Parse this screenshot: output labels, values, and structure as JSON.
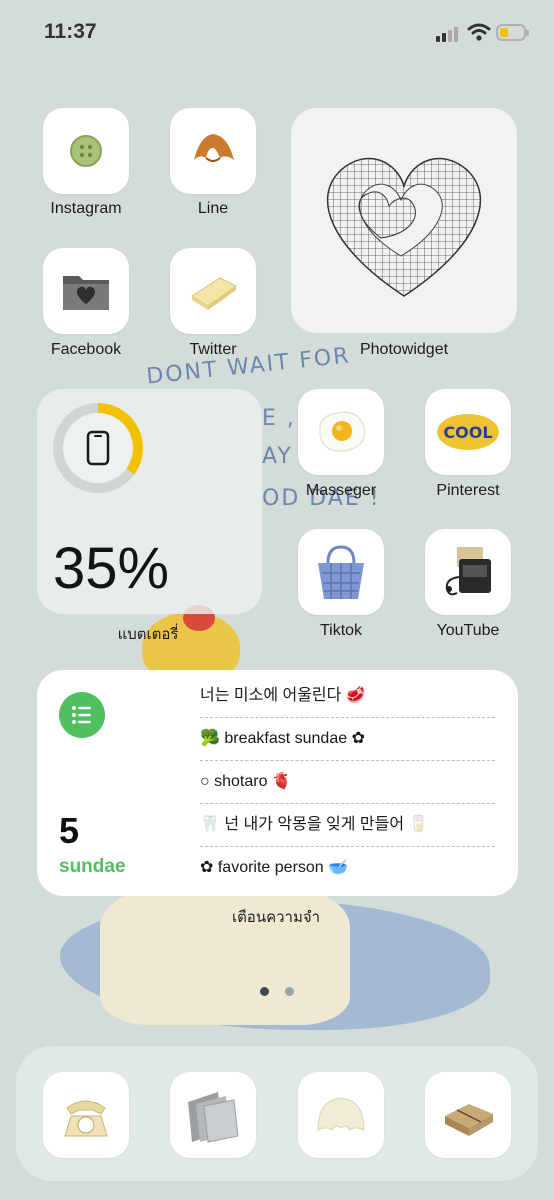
{
  "status_bar": {
    "time": "11:37",
    "battery_level": 0.35
  },
  "wallpaper_text": {
    "line1": "DONT WAIT FOR",
    "line2": "E ,",
    "line3": "AY   BE",
    "line4": "OD DAE !"
  },
  "apps_row1": [
    {
      "label": "Instagram",
      "icon": "button-icon"
    },
    {
      "label": "Line",
      "icon": "croissant-icon"
    }
  ],
  "apps_row2": [
    {
      "label": "Facebook",
      "icon": "folder-heart-icon"
    },
    {
      "label": "Twitter",
      "icon": "butter-icon"
    }
  ],
  "photo_widget": {
    "label": "Photowidget",
    "icon": "wire-heart-icon"
  },
  "battery_widget": {
    "percent_text": "35%",
    "label": "แบตเตอรี่",
    "level": 0.35,
    "icon": "phone-icon"
  },
  "apps_row3": [
    {
      "label": "Masseger",
      "icon": "fried-egg-icon"
    },
    {
      "label": "Pinterest",
      "icon": "cool-badge-icon",
      "badge_text": "COOL"
    }
  ],
  "apps_row4": [
    {
      "label": "Tiktok",
      "icon": "basket-icon"
    },
    {
      "label": "YouTube",
      "icon": "cassette-player-icon"
    }
  ],
  "reminders_widget": {
    "count": "5",
    "list_name": "sundae",
    "items": [
      {
        "text": "너는 미소에 어울린다 🥩"
      },
      {
        "text": "🥦 breakfast sundae ✿"
      },
      {
        "text": "○ shotaro 🫀"
      },
      {
        "text": "🦷 넌 내가 악몽을 잊게 만들어 🥛"
      },
      {
        "text": "✿ favorite person 🥣"
      }
    ],
    "label": "เตือนความจำ"
  },
  "page_dots": {
    "count": 2,
    "active": 0
  },
  "dock": [
    {
      "icon": "telephone-icon"
    },
    {
      "icon": "file-folders-icon"
    },
    {
      "icon": "shell-icon"
    },
    {
      "icon": "parcel-icon"
    }
  ],
  "colors": {
    "background": "#d3dcd8",
    "accent_green": "#4fbf5f",
    "battery_yellow": "#f2c200"
  }
}
